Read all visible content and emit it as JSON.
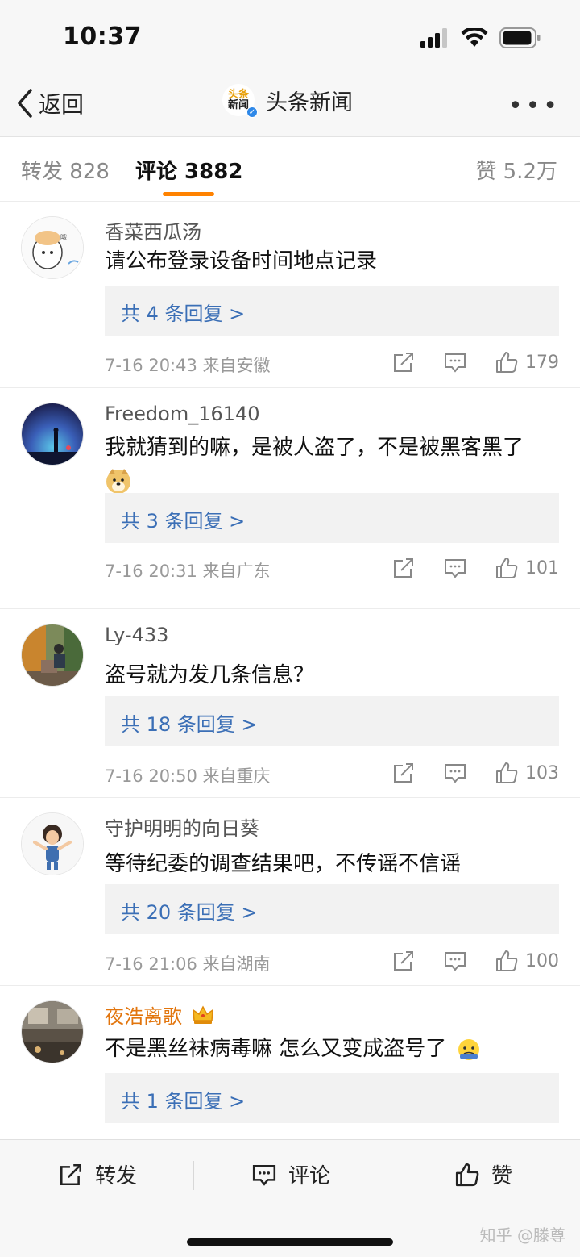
{
  "status": {
    "time": "10:37"
  },
  "nav": {
    "back_label": "返回",
    "logo_line1": "头条",
    "logo_line2": "新闻",
    "title": "头条新闻"
  },
  "tabs": {
    "repost": "转发 828",
    "comment": "评论 3882",
    "likes": "赞 5.2万"
  },
  "comments": [
    {
      "name": "香菜西瓜汤",
      "text": "请公布登录设备时间地点记录",
      "replies": "共 4 条回复 >",
      "meta": "7-16 20:43  来自安徽",
      "likes": "179"
    },
    {
      "name": "Freedom_16140",
      "text": "我就猜到的嘛，是被人盗了，不是被黑客黑了",
      "replies": "共 3 条回复 >",
      "meta": "7-16 20:31  来自广东",
      "likes": "101"
    },
    {
      "name": "Ly-433",
      "text": "盗号就为发几条信息？",
      "replies": "共 18 条回复 >",
      "meta": "7-16 20:50  来自重庆",
      "likes": "103"
    },
    {
      "name": "守护明明的向日葵",
      "text": "等待纪委的调查结果吧，不传谣不信谣",
      "replies": "共 20 条回复 >",
      "meta": "7-16 21:06  来自湖南",
      "likes": "100"
    },
    {
      "name": "夜浩离歌",
      "text": "不是黑丝袜病毒嘛 怎么又变成盗号了",
      "replies": "共 1 条回复 >"
    }
  ],
  "bottom": {
    "repost": "转发",
    "comment": "评论",
    "like": "赞"
  },
  "watermark": "知乎 @滕尊",
  "colors": {
    "accent": "#ff8200",
    "link": "#3b6fb6",
    "vip_name": "#e2750d"
  }
}
